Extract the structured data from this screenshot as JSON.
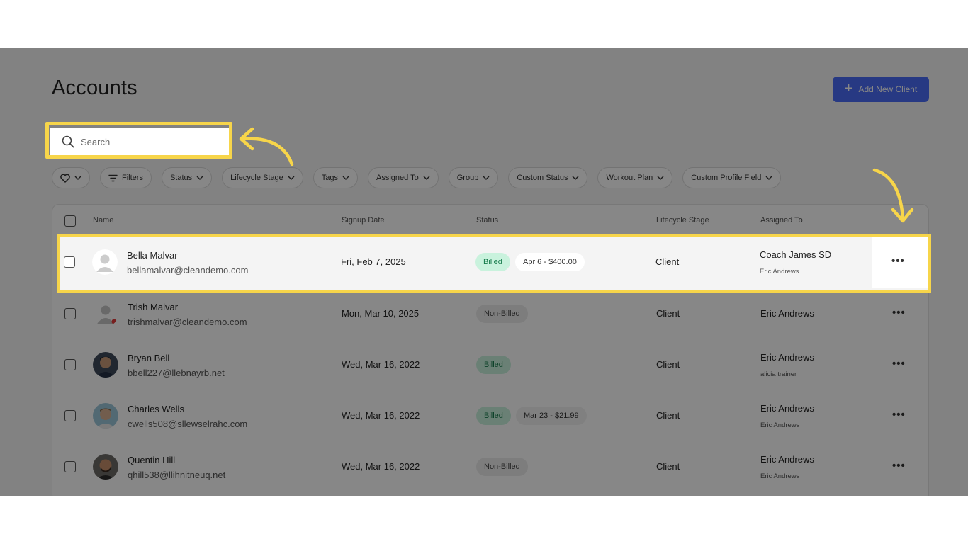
{
  "page": {
    "title": "Accounts",
    "add_button_label": "Add New Client",
    "search_placeholder": "Search"
  },
  "filters": [
    {
      "label": ""
    },
    {
      "label": "Filters"
    },
    {
      "label": "Status"
    },
    {
      "label": "Lifecycle Stage"
    },
    {
      "label": "Tags"
    },
    {
      "label": "Assigned To"
    },
    {
      "label": "Group"
    },
    {
      "label": "Custom Status"
    },
    {
      "label": "Workout Plan"
    },
    {
      "label": "Custom Profile Field"
    }
  ],
  "table": {
    "columns": {
      "name": "Name",
      "signup": "Signup Date",
      "status": "Status",
      "stage": "Lifecycle Stage",
      "assigned": "Assigned To"
    },
    "rows": [
      {
        "name": "Bella Malvar",
        "email": "bellamalvar@cleandemo.com",
        "signup": "Fri, Feb 7, 2025",
        "status": "Billed",
        "plan": "Apr 6 - $400.00",
        "stage": "Client",
        "assigned": "Coach James SD",
        "assigned_sub": "Eric Andrews"
      },
      {
        "name": "Trish Malvar",
        "email": "trishmalvar@cleandemo.com",
        "signup": "Mon, Mar 10, 2025",
        "status": "Non-Billed",
        "plan": "",
        "stage": "Client",
        "assigned": "Eric Andrews",
        "assigned_sub": ""
      },
      {
        "name": "Bryan Bell",
        "email": "bbell227@llebnayrb.net",
        "signup": "Wed, Mar 16, 2022",
        "status": "Billed",
        "plan": "",
        "stage": "Client",
        "assigned": "Eric Andrews",
        "assigned_sub": "alicia trainer"
      },
      {
        "name": "Charles Wells",
        "email": "cwells508@sllewselrahc.com",
        "signup": "Wed, Mar 16, 2022",
        "status": "Billed",
        "plan": "Mar 23 - $21.99",
        "stage": "Client",
        "assigned": "Eric Andrews",
        "assigned_sub": "Eric Andrews"
      },
      {
        "name": "Quentin Hill",
        "email": "qhill538@llihnitneuq.net",
        "signup": "Wed, Mar 16, 2022",
        "status": "Non-Billed",
        "plan": "",
        "stage": "Client",
        "assigned": "Eric Andrews",
        "assigned_sub": "Eric Andrews"
      }
    ],
    "more_label": "•••"
  },
  "colors": {
    "primary": "#4a6cf7",
    "highlight": "#f7d54a",
    "billed_bg": "#c9f2dd",
    "billed_text": "#157a4a"
  },
  "icons": {
    "search": "search-icon",
    "favorite": "heart-icon",
    "filter": "filter-icon",
    "chevron": "chevron-down-icon",
    "more": "more-horizontal-icon",
    "add": "plus-icon"
  }
}
